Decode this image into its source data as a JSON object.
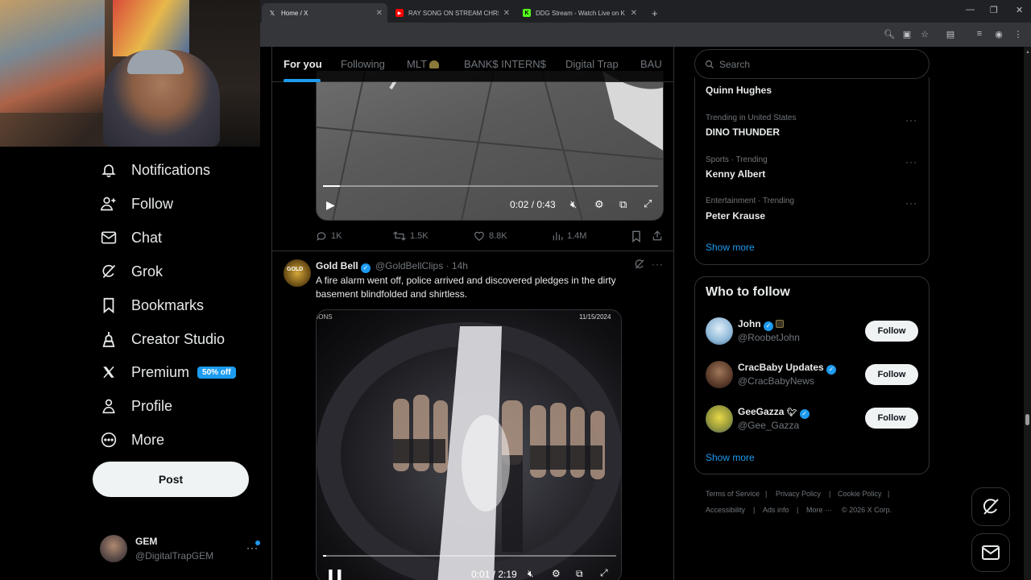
{
  "browser": {
    "tabs": [
      {
        "title": "Home / X",
        "favicon": "x-logo-icon"
      },
      {
        "title": "RAY SONG ON STREAM CHRIS",
        "favicon": "youtube-icon"
      },
      {
        "title": "DDG Stream - Watch Live on K",
        "favicon": "kick-icon"
      }
    ],
    "new_tab_glyph": "+"
  },
  "sidebar": {
    "items": [
      {
        "label": "Notifications",
        "icon": "bell-icon"
      },
      {
        "label": "Follow",
        "icon": "person-plus-icon"
      },
      {
        "label": "Chat",
        "icon": "mail-icon"
      },
      {
        "label": "Grok",
        "icon": "grok-icon"
      },
      {
        "label": "Bookmarks",
        "icon": "bookmark-icon"
      },
      {
        "label": "Creator Studio",
        "icon": "creator-studio-icon"
      },
      {
        "label": "Premium",
        "icon": "x-logo-icon",
        "badge": "50% off"
      },
      {
        "label": "Profile",
        "icon": "person-icon"
      },
      {
        "label": "More",
        "icon": "more-circle-icon"
      }
    ],
    "post_label": "Post",
    "account": {
      "name": "GEM",
      "handle": "@DigitalTrapGEM"
    }
  },
  "feed": {
    "tabs": [
      "For you",
      "Following",
      "MLT",
      "BANK$ INTERN$",
      "Digital Trap",
      "BAU"
    ],
    "active_tab": "For you",
    "post1": {
      "time": "0:02 / 0:43",
      "progress": 0.05,
      "stats": {
        "replies": "1K",
        "reposts": "1.5K",
        "likes": "8.8K",
        "views": "1.4M"
      }
    },
    "post2": {
      "name": "Gold Bell",
      "handle": "@GoldBellClips",
      "time_ago": "14h",
      "separator": "·",
      "text": "A fire alarm went off, police arrived and discovered pledges in the dirty basement blindfolded and shirtless.",
      "video_overlay_date": "11/15/2024",
      "video_overlay_brand": "IONS",
      "time": "0:01 / 2:19",
      "progress": 0.01
    }
  },
  "right": {
    "search_placeholder": "Search",
    "trends": [
      {
        "meta": "",
        "title": "Quinn Hughes"
      },
      {
        "meta": "Trending in United States",
        "title": "DINO THUNDER"
      },
      {
        "meta": "Sports · Trending",
        "title": "Kenny Albert"
      },
      {
        "meta": "Entertainment · Trending",
        "title": "Peter Krause"
      }
    ],
    "trends_show_more": "Show more",
    "who_to_follow": {
      "title": "Who to follow",
      "users": [
        {
          "name": "John",
          "handle": "@RoobetJohn",
          "button": "Follow"
        },
        {
          "name": "CracBaby Updates",
          "handle": "@CracBabyNews",
          "button": "Follow"
        },
        {
          "name": "GeeGazza",
          "handle": "@Gee_Gazza",
          "button": "Follow"
        }
      ],
      "show_more": "Show more"
    },
    "footer": {
      "links": [
        "Terms of Service",
        "Privacy Policy",
        "Cookie Policy",
        "Accessibility",
        "Ads info",
        "More ···"
      ],
      "separator": "|",
      "copyright": "© 2026 X Corp."
    }
  },
  "colors": {
    "accent": "#1d9bf0",
    "background": "#000000",
    "border": "#2f3336",
    "muted": "#71767b"
  }
}
